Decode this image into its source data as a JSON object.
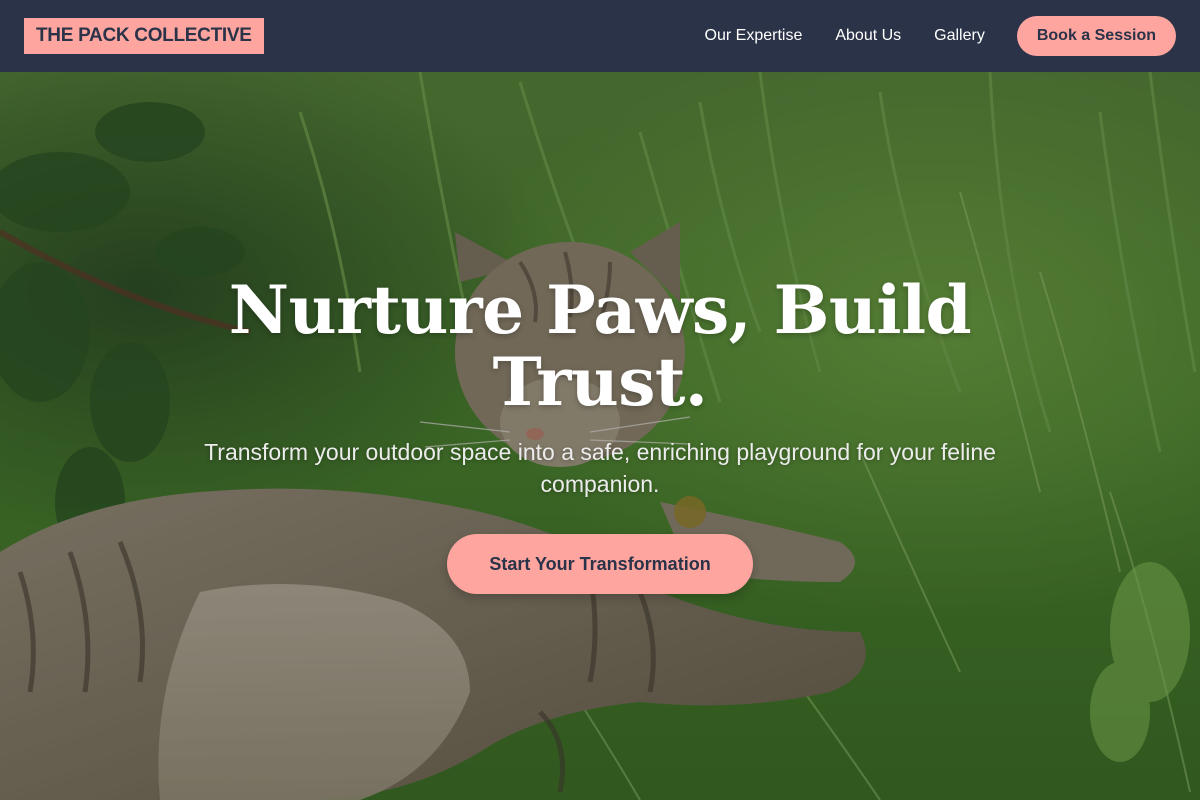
{
  "nav": {
    "logo": "THE PACK COLLECTIVE",
    "links": [
      {
        "label": "Our Expertise"
      },
      {
        "label": "About Us"
      },
      {
        "label": "Gallery"
      }
    ],
    "cta": "Book a Session"
  },
  "hero": {
    "title": "Nurture Paws, Build Trust.",
    "subtitle": "Transform your outdoor space into a safe, enriching playground for your feline companion.",
    "cta": "Start Your Transformation",
    "background_image": "tabby cat lying in green grass"
  },
  "colors": {
    "nav_background": "#2a3347",
    "accent": "#fea5a0",
    "text_dark": "#2a3347",
    "text_light": "#ffffff"
  }
}
